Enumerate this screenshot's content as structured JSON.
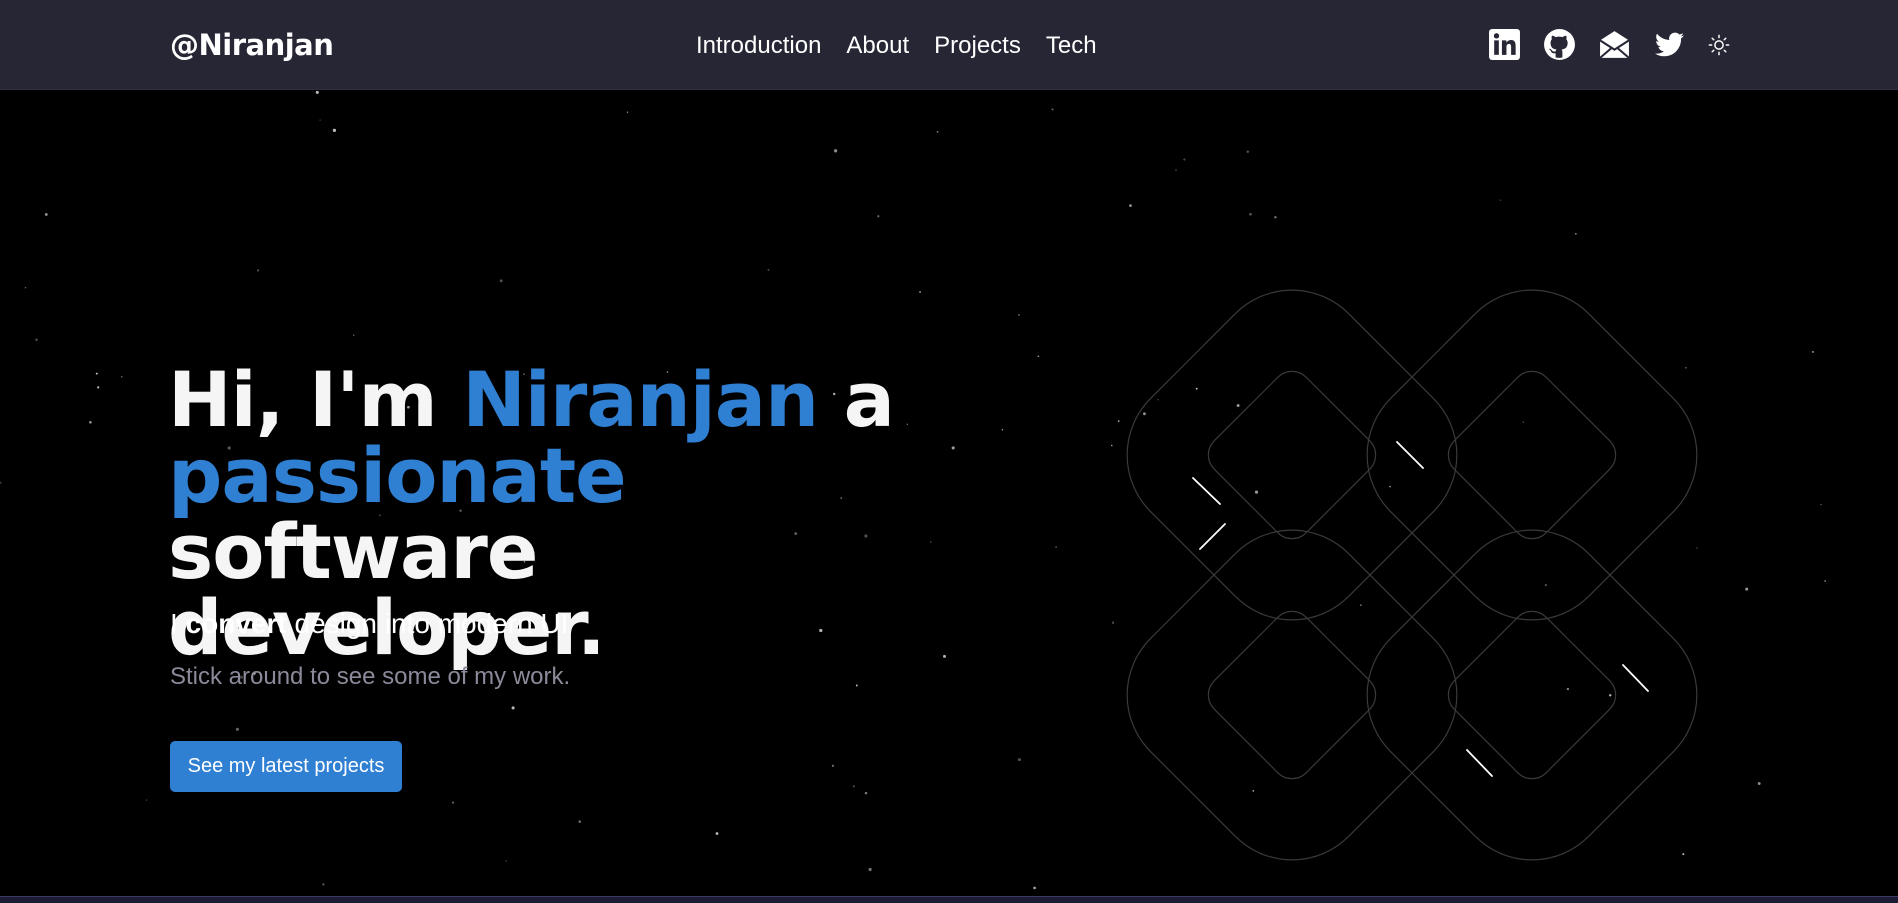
{
  "navbar": {
    "brand": "@Niranjan",
    "links": [
      "Introduction",
      "About",
      "Projects",
      "Tech"
    ],
    "social_icons": [
      "linkedin-icon",
      "github-icon",
      "mail-icon",
      "twitter-icon",
      "theme-toggle-sun-icon"
    ]
  },
  "hero": {
    "headline": {
      "part1": "Hi, I'm ",
      "name": "Niranjan",
      "part2": " a",
      "passionate": "passionate",
      "part3": " software",
      "part4": "developer."
    },
    "tagline": {
      "prefix": "I ",
      "bold": "convert",
      "suffix": " design into modern UI"
    },
    "subtext": "Stick around to see some of my work.",
    "cta_label": "See my latest projects"
  },
  "colors": {
    "accent": "#2f7fd3",
    "navbar_bg": "#272635",
    "background": "#000000",
    "muted_text": "#8a8a9a"
  }
}
